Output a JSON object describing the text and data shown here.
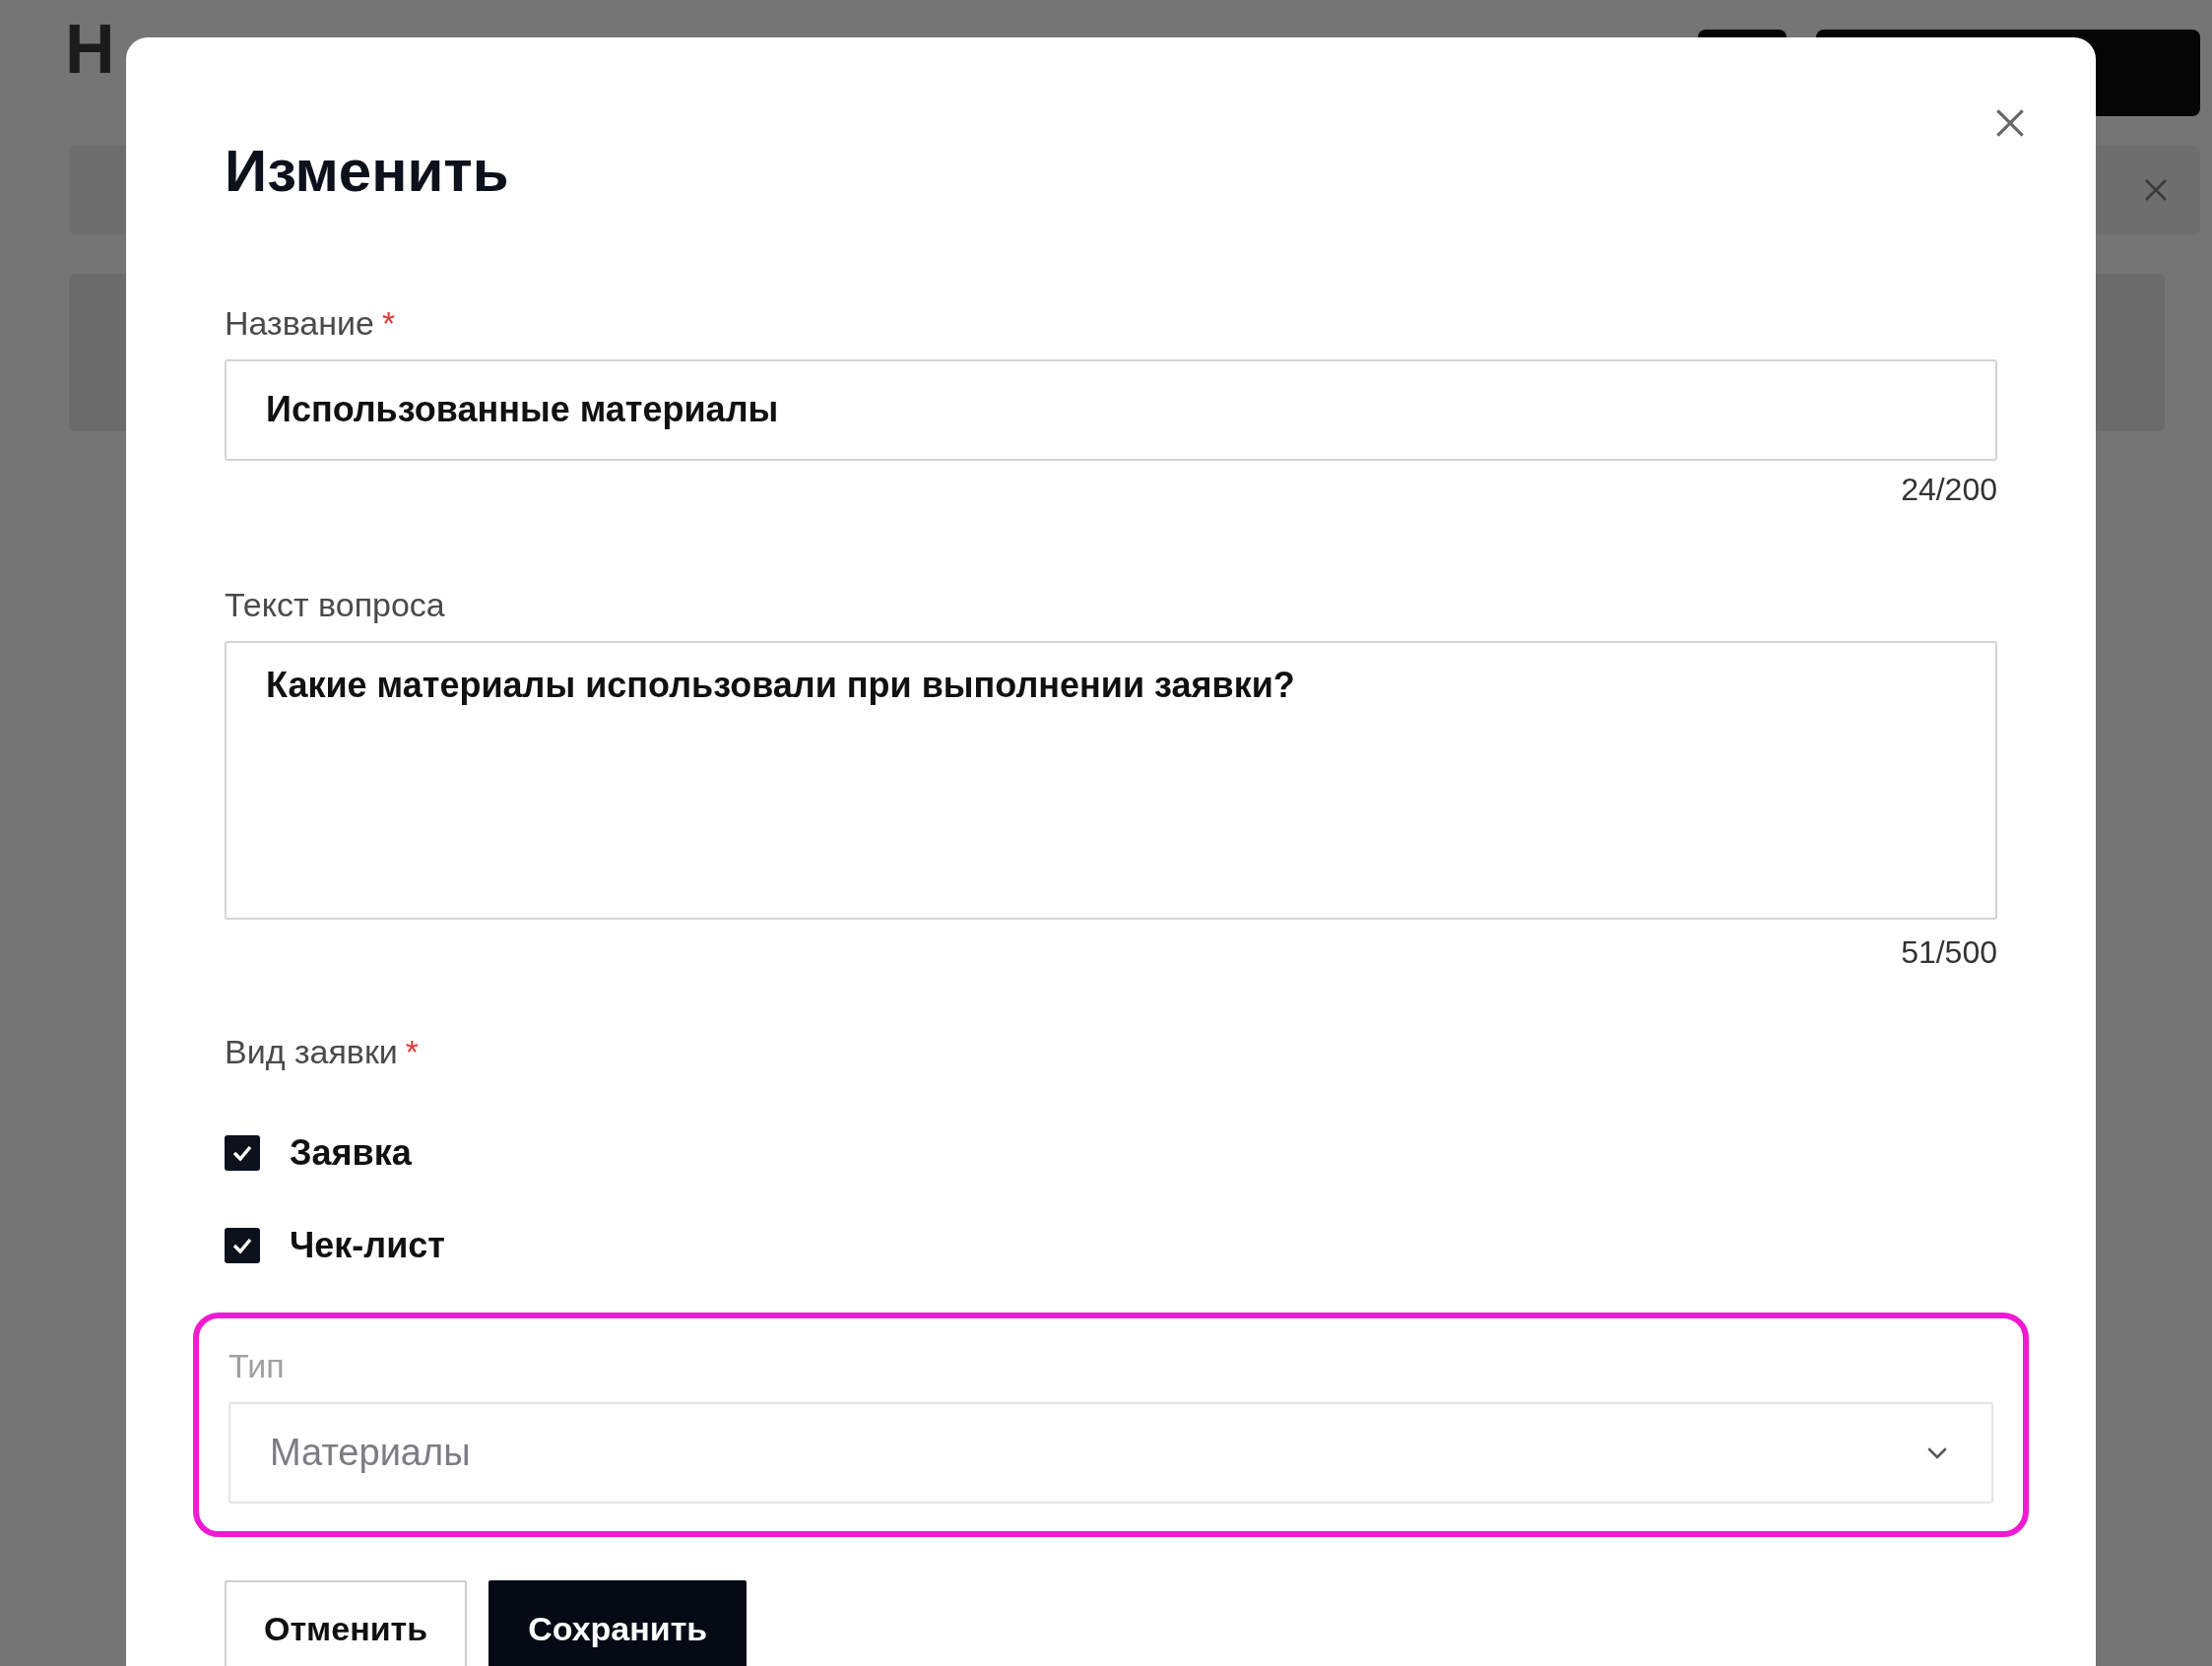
{
  "background": {
    "title": "Н"
  },
  "dialog": {
    "title": "Изменить",
    "fields": [
      {
        "kind": "input",
        "label": "Название",
        "required_mark": "*",
        "value": "Использованные материалы",
        "counter": "24/200"
      },
      {
        "kind": "textarea",
        "label": "Текст вопроса",
        "value": "Какие материалы использовали при выполнении заявки?",
        "counter": "51/500"
      }
    ],
    "request_type": {
      "label": "Вид заявки",
      "required_mark": "*",
      "options": [
        {
          "label": "Заявка",
          "checked": true
        },
        {
          "label": "Чек-лист",
          "checked": true
        }
      ]
    },
    "type_field": {
      "label": "Тип",
      "value": "Материалы",
      "disabled": true,
      "highlighted": true
    },
    "buttons": [
      {
        "kind": "secondary",
        "label": "Отменить"
      },
      {
        "kind": "primary",
        "label": "Сохранить"
      }
    ]
  }
}
